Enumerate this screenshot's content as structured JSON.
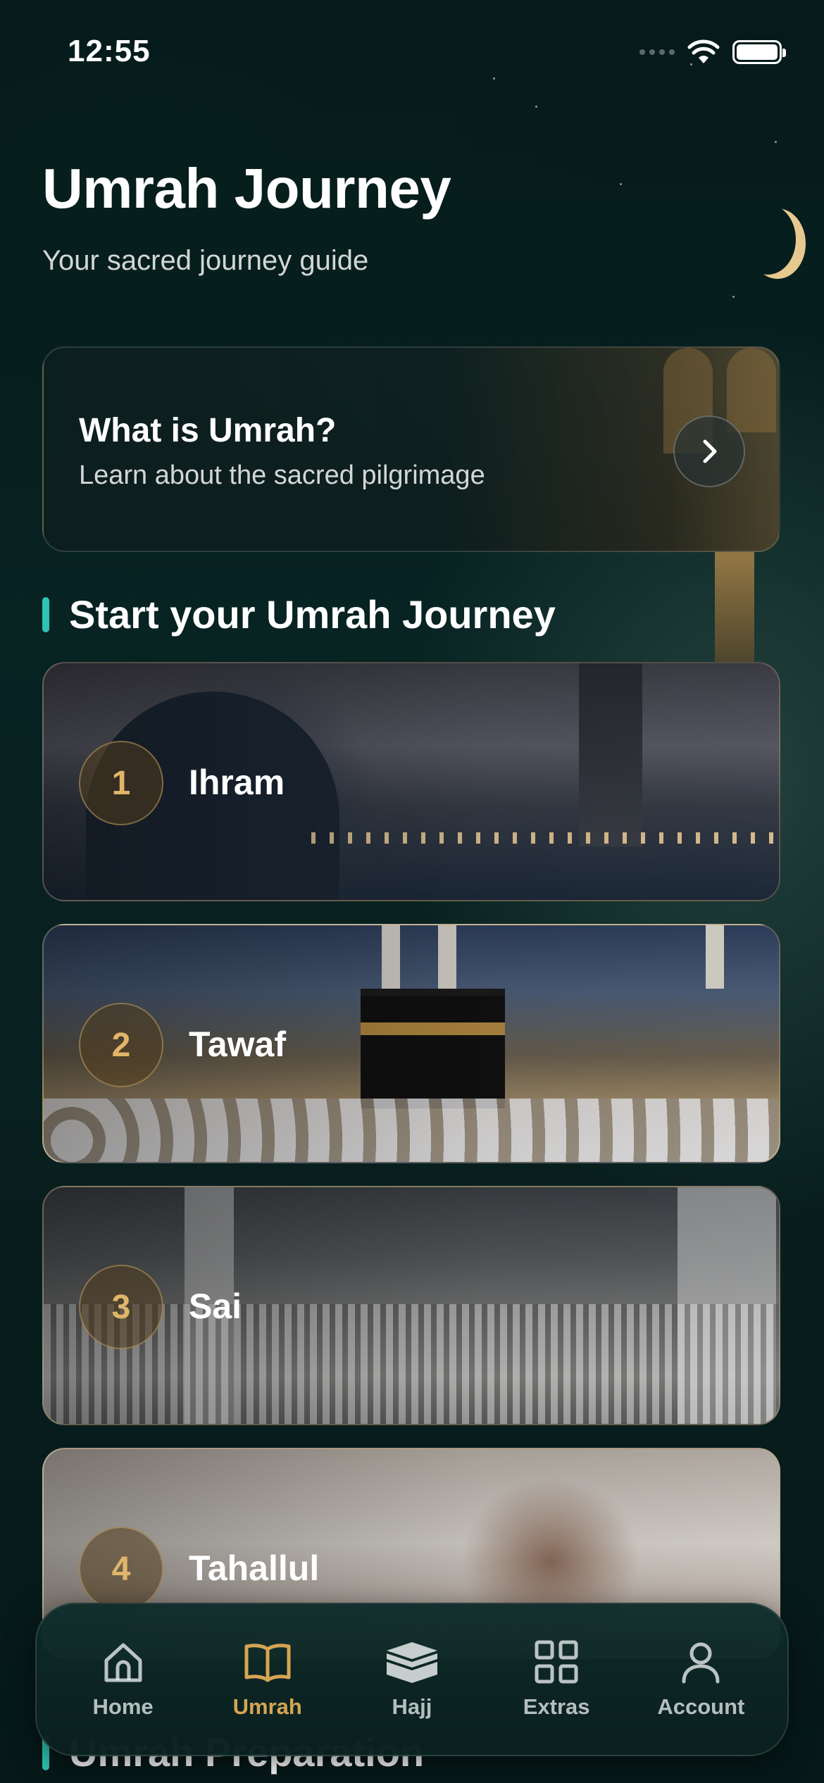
{
  "status_bar": {
    "time": "12:55"
  },
  "header": {
    "title": "Umrah Journey",
    "subtitle": "Your sacred journey guide"
  },
  "info_card": {
    "title": "What is Umrah?",
    "subtitle": "Learn about the sacred pilgrimage"
  },
  "journey_section": {
    "heading": "Start your Umrah Journey",
    "steps": [
      {
        "number": "1",
        "label": "Ihram"
      },
      {
        "number": "2",
        "label": "Tawaf"
      },
      {
        "number": "3",
        "label": "Sai"
      },
      {
        "number": "4",
        "label": "Tahallul"
      }
    ]
  },
  "preparation_section": {
    "heading": "Umrah Preparation"
  },
  "tabbar": {
    "active": "Umrah",
    "accent_color": "#d6a552",
    "items": [
      {
        "label": "Home",
        "icon": "home-icon"
      },
      {
        "label": "Umrah",
        "icon": "book-icon"
      },
      {
        "label": "Hajj",
        "icon": "kaaba-icon"
      },
      {
        "label": "Extras",
        "icon": "grid-icon"
      },
      {
        "label": "Account",
        "icon": "user-icon"
      }
    ]
  }
}
